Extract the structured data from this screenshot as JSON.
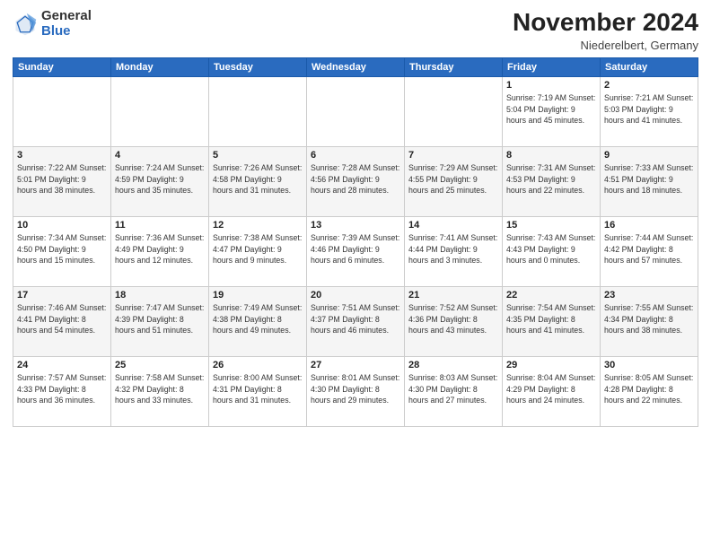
{
  "header": {
    "logo_general": "General",
    "logo_blue": "Blue",
    "month_title": "November 2024",
    "location": "Niederelbert, Germany"
  },
  "weekdays": [
    "Sunday",
    "Monday",
    "Tuesday",
    "Wednesday",
    "Thursday",
    "Friday",
    "Saturday"
  ],
  "weeks": [
    [
      {
        "day": "",
        "info": ""
      },
      {
        "day": "",
        "info": ""
      },
      {
        "day": "",
        "info": ""
      },
      {
        "day": "",
        "info": ""
      },
      {
        "day": "",
        "info": ""
      },
      {
        "day": "1",
        "info": "Sunrise: 7:19 AM\nSunset: 5:04 PM\nDaylight: 9 hours\nand 45 minutes."
      },
      {
        "day": "2",
        "info": "Sunrise: 7:21 AM\nSunset: 5:03 PM\nDaylight: 9 hours\nand 41 minutes."
      }
    ],
    [
      {
        "day": "3",
        "info": "Sunrise: 7:22 AM\nSunset: 5:01 PM\nDaylight: 9 hours\nand 38 minutes."
      },
      {
        "day": "4",
        "info": "Sunrise: 7:24 AM\nSunset: 4:59 PM\nDaylight: 9 hours\nand 35 minutes."
      },
      {
        "day": "5",
        "info": "Sunrise: 7:26 AM\nSunset: 4:58 PM\nDaylight: 9 hours\nand 31 minutes."
      },
      {
        "day": "6",
        "info": "Sunrise: 7:28 AM\nSunset: 4:56 PM\nDaylight: 9 hours\nand 28 minutes."
      },
      {
        "day": "7",
        "info": "Sunrise: 7:29 AM\nSunset: 4:55 PM\nDaylight: 9 hours\nand 25 minutes."
      },
      {
        "day": "8",
        "info": "Sunrise: 7:31 AM\nSunset: 4:53 PM\nDaylight: 9 hours\nand 22 minutes."
      },
      {
        "day": "9",
        "info": "Sunrise: 7:33 AM\nSunset: 4:51 PM\nDaylight: 9 hours\nand 18 minutes."
      }
    ],
    [
      {
        "day": "10",
        "info": "Sunrise: 7:34 AM\nSunset: 4:50 PM\nDaylight: 9 hours\nand 15 minutes."
      },
      {
        "day": "11",
        "info": "Sunrise: 7:36 AM\nSunset: 4:49 PM\nDaylight: 9 hours\nand 12 minutes."
      },
      {
        "day": "12",
        "info": "Sunrise: 7:38 AM\nSunset: 4:47 PM\nDaylight: 9 hours\nand 9 minutes."
      },
      {
        "day": "13",
        "info": "Sunrise: 7:39 AM\nSunset: 4:46 PM\nDaylight: 9 hours\nand 6 minutes."
      },
      {
        "day": "14",
        "info": "Sunrise: 7:41 AM\nSunset: 4:44 PM\nDaylight: 9 hours\nand 3 minutes."
      },
      {
        "day": "15",
        "info": "Sunrise: 7:43 AM\nSunset: 4:43 PM\nDaylight: 9 hours\nand 0 minutes."
      },
      {
        "day": "16",
        "info": "Sunrise: 7:44 AM\nSunset: 4:42 PM\nDaylight: 8 hours\nand 57 minutes."
      }
    ],
    [
      {
        "day": "17",
        "info": "Sunrise: 7:46 AM\nSunset: 4:41 PM\nDaylight: 8 hours\nand 54 minutes."
      },
      {
        "day": "18",
        "info": "Sunrise: 7:47 AM\nSunset: 4:39 PM\nDaylight: 8 hours\nand 51 minutes."
      },
      {
        "day": "19",
        "info": "Sunrise: 7:49 AM\nSunset: 4:38 PM\nDaylight: 8 hours\nand 49 minutes."
      },
      {
        "day": "20",
        "info": "Sunrise: 7:51 AM\nSunset: 4:37 PM\nDaylight: 8 hours\nand 46 minutes."
      },
      {
        "day": "21",
        "info": "Sunrise: 7:52 AM\nSunset: 4:36 PM\nDaylight: 8 hours\nand 43 minutes."
      },
      {
        "day": "22",
        "info": "Sunrise: 7:54 AM\nSunset: 4:35 PM\nDaylight: 8 hours\nand 41 minutes."
      },
      {
        "day": "23",
        "info": "Sunrise: 7:55 AM\nSunset: 4:34 PM\nDaylight: 8 hours\nand 38 minutes."
      }
    ],
    [
      {
        "day": "24",
        "info": "Sunrise: 7:57 AM\nSunset: 4:33 PM\nDaylight: 8 hours\nand 36 minutes."
      },
      {
        "day": "25",
        "info": "Sunrise: 7:58 AM\nSunset: 4:32 PM\nDaylight: 8 hours\nand 33 minutes."
      },
      {
        "day": "26",
        "info": "Sunrise: 8:00 AM\nSunset: 4:31 PM\nDaylight: 8 hours\nand 31 minutes."
      },
      {
        "day": "27",
        "info": "Sunrise: 8:01 AM\nSunset: 4:30 PM\nDaylight: 8 hours\nand 29 minutes."
      },
      {
        "day": "28",
        "info": "Sunrise: 8:03 AM\nSunset: 4:30 PM\nDaylight: 8 hours\nand 27 minutes."
      },
      {
        "day": "29",
        "info": "Sunrise: 8:04 AM\nSunset: 4:29 PM\nDaylight: 8 hours\nand 24 minutes."
      },
      {
        "day": "30",
        "info": "Sunrise: 8:05 AM\nSunset: 4:28 PM\nDaylight: 8 hours\nand 22 minutes."
      }
    ]
  ]
}
